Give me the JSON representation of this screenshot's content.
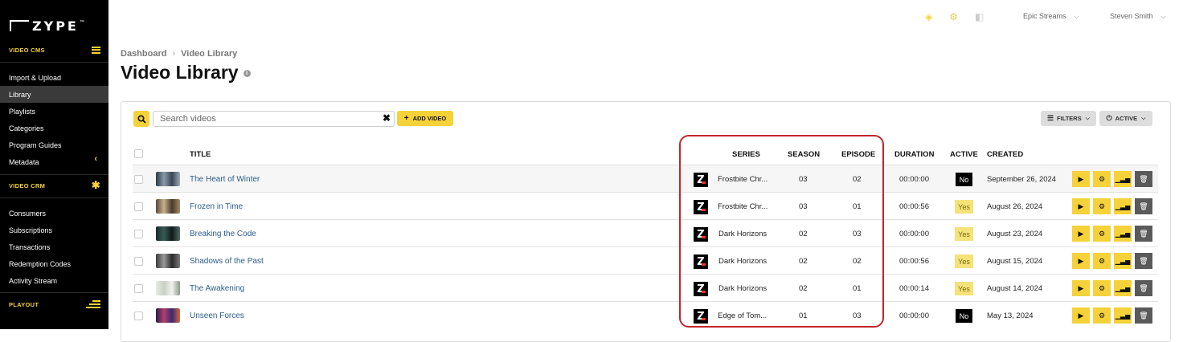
{
  "brand": {
    "name": "ZYPE",
    "tm": "™"
  },
  "sidebar": {
    "video_cms": "VIDEO CMS",
    "cms_items": [
      {
        "label": "Import & Upload"
      },
      {
        "label": "Library"
      },
      {
        "label": "Playlists"
      },
      {
        "label": "Categories"
      },
      {
        "label": "Program Guides"
      },
      {
        "label": "Metadata"
      }
    ],
    "video_crm": "VIDEO CRM",
    "crm_items": [
      {
        "label": "Consumers"
      },
      {
        "label": "Subscriptions"
      },
      {
        "label": "Transactions"
      },
      {
        "label": "Redemption Codes"
      },
      {
        "label": "Activity Stream"
      }
    ],
    "playout": "PLAYOUT",
    "active_item": "Library"
  },
  "topbar": {
    "account": "Epic Streams",
    "user": "Steven Smith"
  },
  "breadcrumb": {
    "items": [
      "Dashboard",
      "Video Library"
    ]
  },
  "page": {
    "title": "Video Library"
  },
  "toolbar": {
    "search_placeholder": "Search videos",
    "add_label": "ADD VIDEO",
    "filters_label": "FILTERS",
    "active_label": "ACTIVE"
  },
  "table": {
    "headers": {
      "title": "TITLE",
      "series": "SERIES",
      "season": "SEASON",
      "episode": "EPISODE",
      "duration": "DURATION",
      "active": "ACTIVE",
      "created": "CREATED"
    },
    "rows": [
      {
        "title": "The Heart of Winter",
        "series": "Frostbite Chr...",
        "season": "03",
        "episode": "02",
        "duration": "00:00:00",
        "active": "No",
        "created": "September 26, 2024"
      },
      {
        "title": "Frozen in Time",
        "series": "Frostbite Chr...",
        "season": "03",
        "episode": "01",
        "duration": "00:00:56",
        "active": "Yes",
        "created": "August 26, 2024"
      },
      {
        "title": "Breaking the Code",
        "series": "Dark Horizons",
        "season": "02",
        "episode": "03",
        "duration": "00:00:00",
        "active": "Yes",
        "created": "August 23, 2024"
      },
      {
        "title": "Shadows of the Past",
        "series": "Dark Horizons",
        "season": "02",
        "episode": "02",
        "duration": "00:00:56",
        "active": "Yes",
        "created": "August 15, 2024"
      },
      {
        "title": "The Awakening",
        "series": "Dark Horizons",
        "season": "02",
        "episode": "01",
        "duration": "00:00:14",
        "active": "Yes",
        "created": "August 14, 2024"
      },
      {
        "title": "Unseen Forces",
        "series": "Edge of Tom...",
        "season": "01",
        "episode": "03",
        "duration": "00:00:00",
        "active": "No",
        "created": "May 13, 2024"
      }
    ]
  },
  "colors": {
    "accent": "#f5d23a",
    "link": "#2a5c8a",
    "highlight": "#c0262d",
    "sidebar": "#000000"
  }
}
